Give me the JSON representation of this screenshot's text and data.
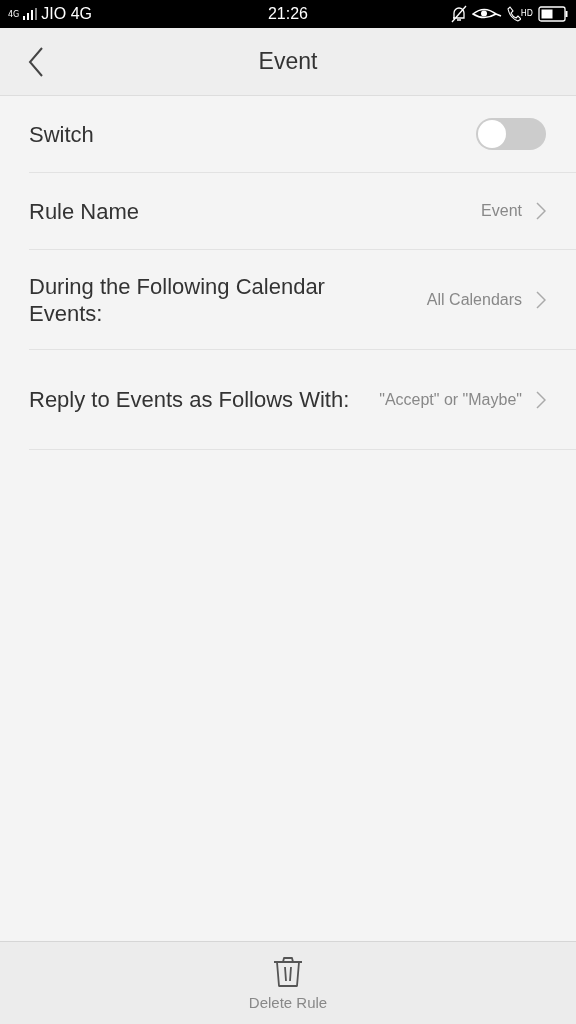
{
  "status_bar": {
    "network_type": "4G",
    "carrier": "JIO 4G",
    "time": "21:26",
    "call_badge": "HD"
  },
  "header": {
    "title": "Event"
  },
  "rows": [
    {
      "kind": "toggle",
      "label": "Switch",
      "on": false
    },
    {
      "kind": "link",
      "label": "Rule Name",
      "value": "Event"
    },
    {
      "kind": "link",
      "label": "During the Following Calendar Events:",
      "value": "All Calendars"
    },
    {
      "kind": "link",
      "label": "Reply to Events as Follows With:",
      "value": "\"Accept\" or \"Maybe\""
    }
  ],
  "bottom_bar": {
    "action": "Delete Rule"
  }
}
